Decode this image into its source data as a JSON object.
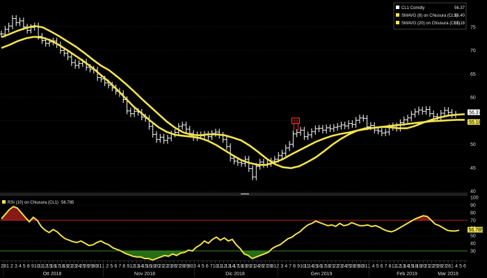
{
  "chart_data": [
    {
      "type": "line",
      "panel": "price",
      "ylim": [
        40,
        80
      ],
      "y_ticks": [
        40,
        45,
        50,
        55,
        60,
        65,
        70,
        75
      ],
      "legend": [
        {
          "symbol": "CL1 Comdty",
          "value": "56.37",
          "color": "#ffffff"
        },
        {
          "symbol": "SMAVG (8)  on Chiusura (CL1)",
          "value": "56.40",
          "color": "#f2e34e"
        },
        {
          "symbol": "SMAVG (20)  on Chiusura (CL1)",
          "value": "55.18",
          "color": "#f2e34e"
        }
      ],
      "last_price_labels": [
        "56.37",
        "55.18"
      ],
      "series": [
        {
          "name": "CL1 Comdty",
          "kind": "hlc_bars",
          "x_start": 2,
          "x_end": 655,
          "values": [
            73.5,
            74.5,
            75.2,
            76.8,
            75.9,
            76.3,
            75.0,
            74.3,
            74.9,
            75.2,
            73.0,
            72.1,
            71.5,
            71.8,
            72.0,
            71.2,
            70.0,
            69.4,
            68.6,
            67.4,
            66.8,
            67.2,
            67.5,
            66.4,
            66.0,
            65.8,
            64.2,
            63.9,
            63.1,
            62.6,
            62.0,
            61.3,
            60.8,
            59.5,
            57.1,
            56.5,
            57.0,
            56.8,
            55.8,
            55.5,
            53.8,
            52.1,
            51.0,
            51.5,
            50.8,
            51.3,
            52.2,
            52.5,
            53.8,
            54.1,
            53.2,
            52.3,
            51.4,
            52.0,
            51.8,
            52.1,
            51.6,
            52.3,
            52.6,
            51.9,
            51.0,
            49.5,
            47.0,
            46.4,
            46.1,
            45.9,
            46.8,
            44.8,
            43.0,
            45.3,
            46.2,
            45.7,
            45.9,
            46.4,
            46.8,
            47.6,
            48.1,
            49.2,
            50.0,
            52.2,
            52.5,
            53.0,
            51.6,
            52.0,
            52.7,
            53.3,
            53.4,
            53.0,
            53.5,
            53.3,
            53.6,
            53.8,
            54.1,
            53.9,
            54.4,
            54.2,
            55.1,
            55.6,
            55.5,
            53.7,
            54.0,
            53.0,
            52.8,
            52.4,
            52.6,
            53.6,
            53.9,
            53.4,
            54.6,
            55.2,
            55.6,
            56.4,
            56.9,
            57.3,
            57.0,
            57.4,
            56.5,
            55.9,
            55.8,
            56.6,
            57.2,
            56.8,
            56.3,
            56.4
          ]
        },
        {
          "name": "SMAVG (8)  on Chiusura (CL1)",
          "x_start": 2,
          "x_end": 668,
          "values": [
            72.8,
            73.5,
            74.2,
            74.8,
            75.2,
            74.9,
            74.0,
            73.0,
            71.9,
            70.8,
            69.5,
            68.1,
            66.8,
            65.8,
            64.4,
            62.9,
            61.3,
            59.6,
            58.0,
            56.4,
            54.8,
            53.5,
            52.5,
            52.0,
            51.9,
            52.1,
            52.1,
            51.9,
            51.4,
            50.8,
            49.7,
            48.4,
            47.0,
            45.8,
            45.1,
            44.9,
            45.3,
            46.2,
            47.2,
            48.5,
            49.9,
            51.1,
            52.1,
            52.9,
            53.4,
            53.5,
            53.7,
            53.6,
            53.4,
            53.4,
            53.9,
            54.6,
            55.2,
            55.7,
            56.1,
            56.3,
            56.4
          ]
        },
        {
          "name": "SMAVG (20)  on Chiusura (CL1)",
          "x_start": 2,
          "x_end": 668,
          "values": [
            70.5,
            71.2,
            72.0,
            72.6,
            72.9,
            72.7,
            72.1,
            71.1,
            70.0,
            68.8,
            67.6,
            66.3,
            64.8,
            63.3,
            61.6,
            59.8,
            58.0,
            56.5,
            55.0,
            53.6,
            52.6,
            52.0,
            51.8,
            51.6,
            51.3,
            50.7,
            49.8,
            48.7,
            47.6,
            46.6,
            46.0,
            45.6,
            45.6,
            46.1,
            46.8,
            47.8,
            48.7,
            49.6,
            50.5,
            51.2,
            51.8,
            52.2,
            52.5,
            52.9,
            53.2,
            53.5,
            53.7,
            53.9,
            54.1,
            54.3,
            54.5,
            54.7,
            54.9,
            55.0,
            55.1,
            55.2,
            55.2
          ]
        }
      ],
      "annotations": [
        {
          "kind": "flag",
          "symbol": "53",
          "color": "#ff2d2d"
        }
      ]
    },
    {
      "type": "area",
      "panel": "rsi",
      "ylim": [
        20,
        100
      ],
      "y_ticks": [
        30,
        40,
        50,
        60,
        70,
        80,
        90,
        100
      ],
      "legend": [
        {
          "symbol": "RSI (10)  on Chiusura (CL1)",
          "value": "56.785",
          "color": "#f2e34e"
        }
      ],
      "last_value_label": "56.785",
      "bands": {
        "overbought": 70,
        "oversold": 30,
        "overbought_color": "#c0241f",
        "oversold_color": "#2f8a1c"
      },
      "series": [
        {
          "name": "RSI (10)  on Chiusura (CL1)",
          "x_start": 2,
          "x_end": 660,
          "values": [
            72,
            78,
            84,
            88,
            86,
            80,
            74,
            68,
            74,
            70,
            62,
            57,
            54,
            58,
            55,
            50,
            46,
            44,
            42,
            41,
            43,
            40,
            37,
            38,
            41,
            43,
            40,
            38,
            34,
            32,
            30,
            27,
            25,
            23,
            22,
            22,
            20,
            20,
            18,
            20,
            22,
            24,
            23,
            26,
            24,
            27,
            28,
            31,
            30,
            35,
            38,
            43,
            40,
            45,
            48,
            44,
            47,
            43,
            45,
            38,
            33,
            26,
            24,
            20,
            22,
            24,
            26,
            28,
            33,
            36,
            38,
            42,
            46,
            48,
            52,
            55,
            60,
            64,
            66,
            69,
            67,
            65,
            63,
            64,
            62,
            66,
            63,
            64,
            67,
            65,
            63,
            63,
            64,
            62,
            63,
            61,
            58,
            56,
            55,
            57,
            60,
            63,
            66,
            69,
            72,
            74,
            76,
            75,
            70,
            65,
            63,
            60,
            57,
            56,
            56,
            57
          ]
        }
      ]
    }
  ],
  "x_axis": {
    "day_ticks": [
      "28",
      "1",
      "2",
      "3",
      "4",
      "5",
      "8",
      "9",
      "10",
      "11",
      "12",
      "15",
      "16",
      "17",
      "18",
      "19",
      "22",
      "23",
      "24",
      "25",
      "26",
      "29",
      "30",
      "31",
      "1",
      "2",
      "5",
      "6",
      "7",
      "8",
      "9",
      "12",
      "13",
      "14",
      "15",
      "16",
      "19",
      "20",
      "21",
      "22",
      "23",
      "26",
      "27",
      "28",
      "29",
      "30",
      "3",
      "4",
      "5",
      "6",
      "7",
      "10",
      "11",
      "12",
      "13",
      "14",
      "17",
      "18",
      "19",
      "20",
      "21",
      "24",
      "26",
      "27",
      "28",
      "31",
      "2",
      "3",
      "4",
      "7",
      "8",
      "9",
      "10",
      "11",
      "14",
      "15",
      "16",
      "17",
      "18",
      "21",
      "22",
      "23",
      "24",
      "25",
      "28",
      "29",
      "30",
      "31",
      "1",
      "4",
      "5",
      "6",
      "7",
      "8",
      "11",
      "12",
      "13",
      "14",
      "15",
      "18",
      "19",
      "20",
      "21",
      "22",
      "25",
      "26",
      "27",
      "28",
      "1",
      "4",
      "5",
      "6"
    ],
    "month_labels": [
      "Ott 2018",
      "Nov 2018",
      "Dic 2018",
      "Gen 2019",
      "Feb 2019",
      "Mar 2019"
    ]
  },
  "colors": {
    "background": "#000000",
    "ma": "#f2e34e",
    "price": "#ffffff",
    "grid": "#3a3a3a",
    "flag": "#ff2d2d"
  }
}
